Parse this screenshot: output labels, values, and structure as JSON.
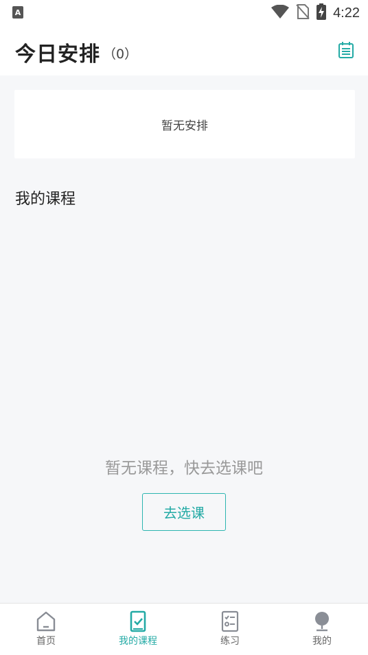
{
  "status": {
    "time": "4:22",
    "icons": [
      "app-a-icon",
      "wifi-icon",
      "no-sim-icon",
      "battery-charging-icon"
    ]
  },
  "header": {
    "title": "今日安排",
    "count": "（0）",
    "action_icon": "calendar-icon"
  },
  "today_card": {
    "empty_text": "暂无安排"
  },
  "courses": {
    "title": "我的课程",
    "empty_text": "暂无课程，快去选课吧",
    "select_button_label": "去选课"
  },
  "tabs": [
    {
      "label": "首页",
      "icon": "home-icon",
      "active": false
    },
    {
      "label": "我的课程",
      "icon": "course-icon",
      "active": true
    },
    {
      "label": "练习",
      "icon": "practice-icon",
      "active": false
    },
    {
      "label": "我的",
      "icon": "profile-icon",
      "active": false
    }
  ],
  "colors": {
    "accent": "#23aaa5",
    "background": "#f6f7f9",
    "muted_text": "#999999"
  }
}
